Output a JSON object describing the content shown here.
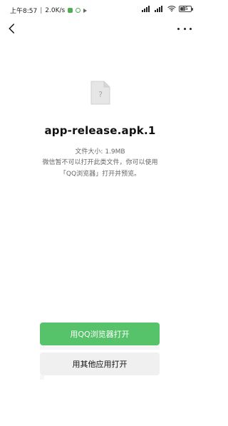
{
  "status_bar": {
    "time": "上午8:57",
    "speed": "2.0K/s",
    "battery_text": "55"
  },
  "nav": {
    "back_icon": "chevron-left-icon",
    "more_icon": "more-icon"
  },
  "file": {
    "icon": "unknown-file-icon",
    "name": "app-release.apk.1",
    "size_text": "文件大小: 1.9MB",
    "message_line_1": "微信暂不可以打开此类文件，你可以使用",
    "message_line_2": "「QQ浏览器」打开并预览。"
  },
  "actions": {
    "open_qq_browser": "用QQ浏览器打开",
    "open_other_app": "用其他应用打开"
  },
  "colors": {
    "primary_green": "#56c26a",
    "secondary_bg": "#f0f0f0",
    "text_gray": "#666666"
  }
}
